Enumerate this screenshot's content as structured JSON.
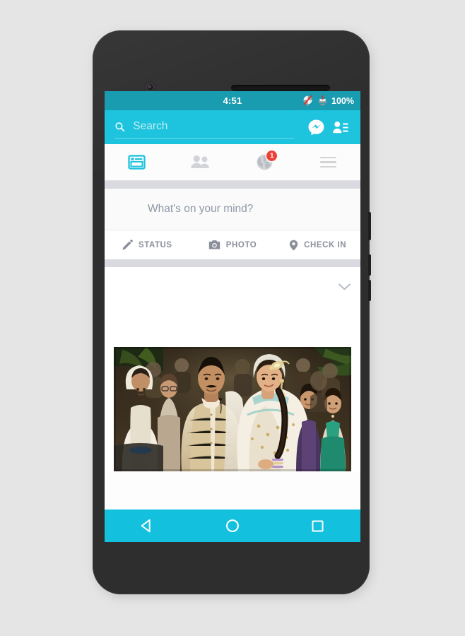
{
  "device": {
    "name": "android-phone",
    "frame_color": "#2e2e2e",
    "page_background": "#e5e5e5"
  },
  "colors": {
    "status_bar": "#1a9cb0",
    "header": "#1ec3de",
    "nav_bar": "#13c1de",
    "accent": "#1ec3de",
    "badge_red": "#ee4036",
    "band_gray": "#d8dadf",
    "muted_text": "#8a8f99"
  },
  "status_bar": {
    "time": "4:51",
    "battery_text": "100%",
    "icons": [
      {
        "name": "sync-disabled-icon",
        "label": "sync off"
      },
      {
        "name": "battery-charging-icon",
        "label": "charging"
      }
    ]
  },
  "header": {
    "search": {
      "icon": "search-icon",
      "placeholder": "Search",
      "value": ""
    },
    "actions": [
      {
        "name": "messenger-icon",
        "label": "Messenger"
      },
      {
        "name": "friend-requests-icon",
        "label": "Friend Requests"
      }
    ]
  },
  "tab_bar": {
    "tabs": [
      {
        "name": "tab-news-feed",
        "icon": "news-feed-icon",
        "label": "News Feed",
        "active": true,
        "badge": ""
      },
      {
        "name": "tab-friends",
        "icon": "friends-icon",
        "label": "Friends",
        "active": false,
        "badge": ""
      },
      {
        "name": "tab-notifications",
        "icon": "globe-icon",
        "label": "Notifications",
        "active": false,
        "badge": "1"
      },
      {
        "name": "tab-menu",
        "icon": "hamburger-icon",
        "label": "Menu",
        "active": false,
        "badge": ""
      }
    ]
  },
  "composer": {
    "prompt": "What's on your mind?",
    "actions": [
      {
        "name": "composer-status",
        "icon": "pencil-icon",
        "label": "STATUS"
      },
      {
        "name": "composer-photo",
        "icon": "camera-icon",
        "label": "PHOTO"
      },
      {
        "name": "composer-checkin",
        "icon": "location-pin-icon",
        "label": "CHECK IN"
      }
    ]
  },
  "post": {
    "author": "",
    "timestamp": "",
    "body": "",
    "menu_icon": "chevron-down-icon",
    "photo": {
      "name": "post-photo",
      "alt": "Wedding couple seated with guests"
    }
  },
  "nav_bar": {
    "buttons": [
      {
        "name": "nav-back-button",
        "icon": "triangle-back-icon",
        "label": "Back"
      },
      {
        "name": "nav-home-button",
        "icon": "circle-home-icon",
        "label": "Home"
      },
      {
        "name": "nav-recents-button",
        "icon": "square-recents-icon",
        "label": "Recents"
      }
    ]
  }
}
